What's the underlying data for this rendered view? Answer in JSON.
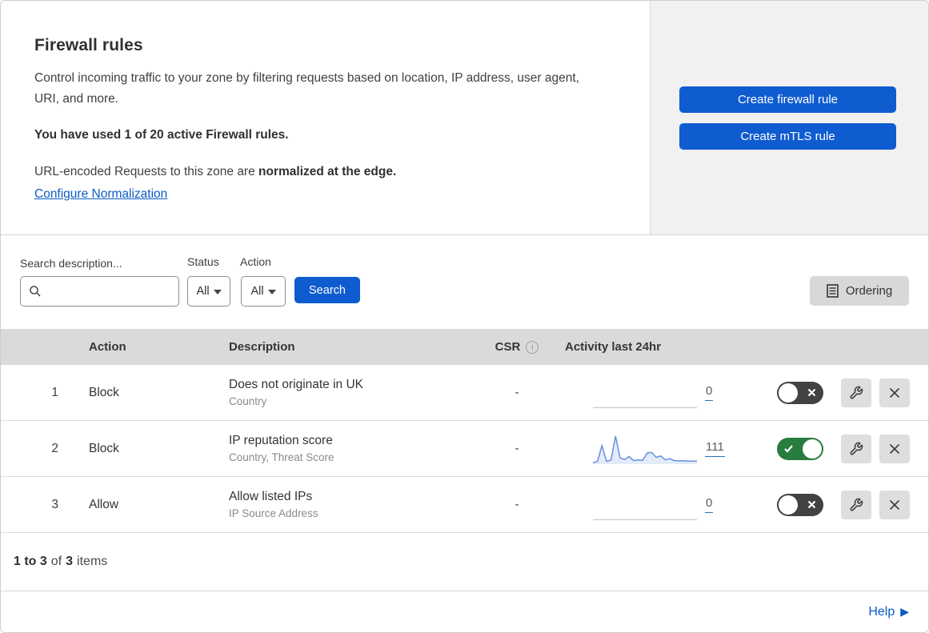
{
  "colors": {
    "accent_blue": "#0f5cd0",
    "link_blue": "#0b5bc8",
    "toggle_on_green": "#287d3e",
    "toggle_off_gray": "#424242",
    "spark_stroke": "#6490df",
    "spark_fill": "#e4ebf8",
    "panel_gray": "#f1f1f1",
    "table_header_gray": "#dadada"
  },
  "header": {
    "title": "Firewall rules",
    "description": "Control incoming traffic to your zone by filtering requests based on location, IP address, user agent, URI, and more.",
    "usage_line": "You have used 1 of 20 active Firewall rules.",
    "normalization_prefix": "URL-encoded Requests to this zone are ",
    "normalization_bold": "normalized at the edge.",
    "normalization_link": "Configure Normalization",
    "create_firewall_button": "Create firewall rule",
    "create_mtls_button": "Create mTLS rule"
  },
  "filters": {
    "search_label": "Search description...",
    "status_label": "Status",
    "status_value": "All",
    "action_label": "Action",
    "action_value": "All",
    "search_button": "Search",
    "ordering_button": "Ordering"
  },
  "table": {
    "columns": {
      "action": "Action",
      "description": "Description",
      "csr": "CSR",
      "csr_info": "i",
      "activity": "Activity last 24hr"
    },
    "rows": [
      {
        "priority": "1",
        "action": "Block",
        "description": "Does not originate in UK",
        "fields": "Country",
        "csr": "-",
        "activity_count": "0",
        "enabled": false,
        "sparkline": null
      },
      {
        "priority": "2",
        "action": "Block",
        "description": "IP reputation score",
        "fields": "Country, Threat Score",
        "csr": "-",
        "activity_count": "111",
        "enabled": true,
        "sparkline": [
          2,
          8,
          65,
          8,
          12,
          100,
          20,
          14,
          25,
          10,
          13,
          11,
          38,
          40,
          22,
          27,
          13,
          17,
          10,
          9,
          10,
          8,
          8,
          8
        ]
      },
      {
        "priority": "3",
        "action": "Allow",
        "description": "Allow listed IPs",
        "fields": "IP Source Address",
        "csr": "-",
        "activity_count": "0",
        "enabled": false,
        "sparkline": null
      }
    ]
  },
  "footer": {
    "range_bold": "1 to 3",
    "of_text": "of",
    "total_bold": "3",
    "items_text": "items",
    "help_label": "Help"
  }
}
